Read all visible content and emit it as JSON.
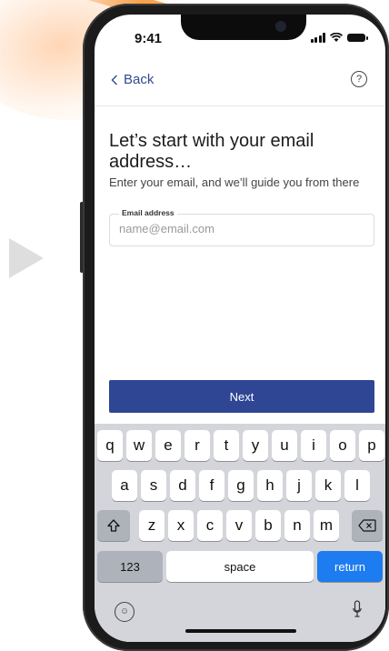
{
  "status": {
    "time": "9:41"
  },
  "nav": {
    "back_label": "Back",
    "help_symbol": "?"
  },
  "content": {
    "headline": "Let’s start with your email address…",
    "subtext": "Enter your email, and we’ll guide you from there",
    "email_field": {
      "label": "Email address",
      "placeholder": "name@email.com",
      "value": ""
    }
  },
  "actions": {
    "next_label": "Next"
  },
  "keyboard": {
    "row1": [
      "q",
      "w",
      "e",
      "r",
      "t",
      "y",
      "u",
      "i",
      "o",
      "p"
    ],
    "row2": [
      "a",
      "s",
      "d",
      "f",
      "g",
      "h",
      "j",
      "k",
      "l"
    ],
    "row3": [
      "z",
      "x",
      "c",
      "v",
      "b",
      "n",
      "m"
    ],
    "numbers_label": "123",
    "space_label": "space",
    "return_label": "return"
  },
  "colors": {
    "primary": "#2f4694",
    "return_key": "#1c7cf0",
    "link": "#2f4b8f"
  },
  "icons": [
    "chevron-left-icon",
    "help-icon",
    "shift-icon",
    "backspace-icon",
    "emoji-icon",
    "microphone-icon",
    "play-arrow-icon"
  ]
}
